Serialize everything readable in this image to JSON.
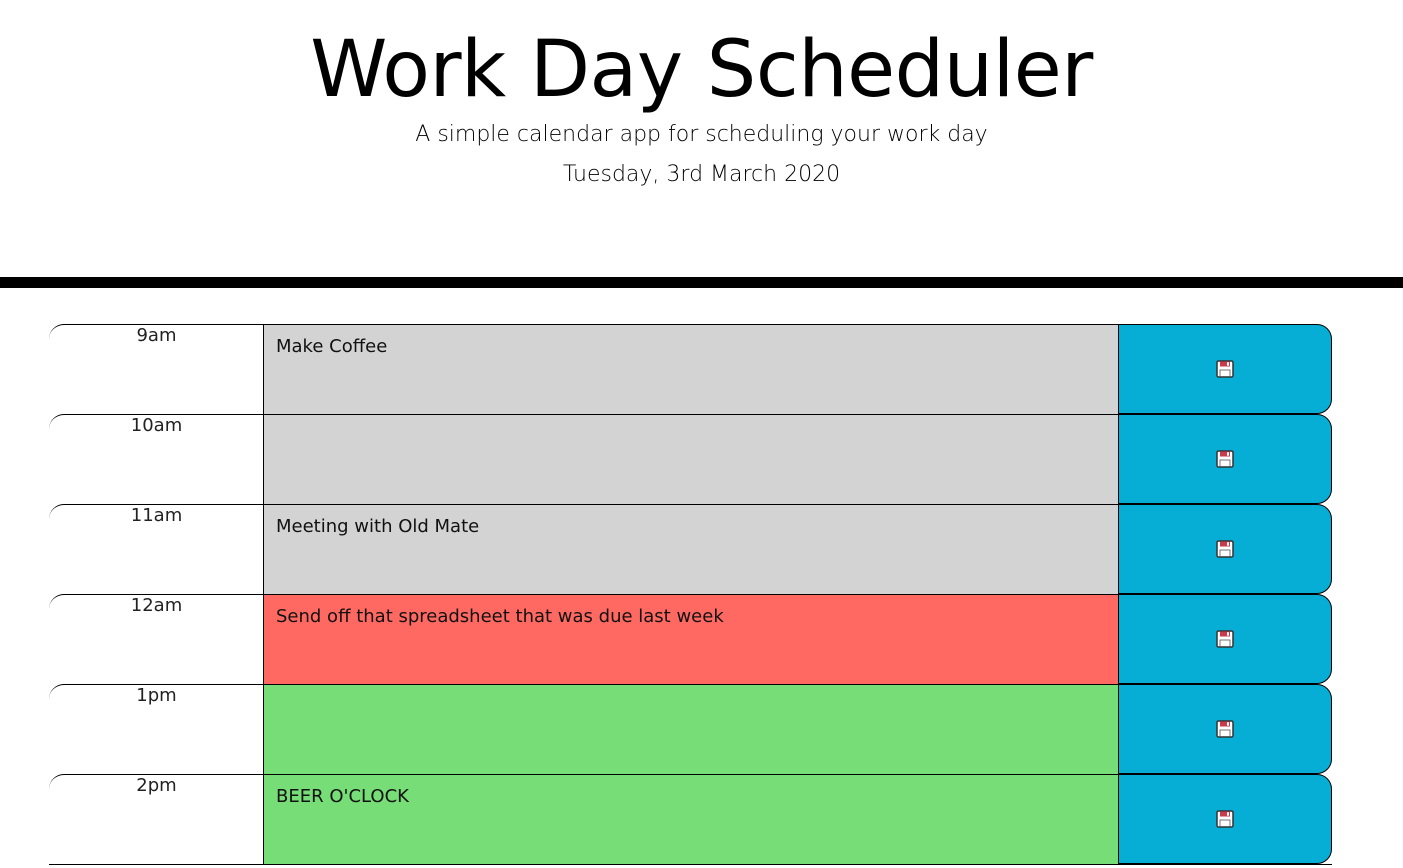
{
  "header": {
    "title": "Work Day Scheduler",
    "subtitle": "A simple calendar app for scheduling your work day",
    "current_day": "Tuesday, 3rd March 2020"
  },
  "colors": {
    "past": "#d3d3d3",
    "present": "#ff6961",
    "future": "#77dd77",
    "save_button": "#06aed5"
  },
  "save_icon": "floppy-disk-icon",
  "rows": [
    {
      "hour": "9am",
      "text": "Make Coffee",
      "state": "past"
    },
    {
      "hour": "10am",
      "text": "",
      "state": "past"
    },
    {
      "hour": "11am",
      "text": "Meeting with Old Mate",
      "state": "past"
    },
    {
      "hour": "12am",
      "text": "Send off that spreadsheet that was due last week",
      "state": "present"
    },
    {
      "hour": "1pm",
      "text": "",
      "state": "future"
    },
    {
      "hour": "2pm",
      "text": "BEER O'CLOCK",
      "state": "future"
    }
  ]
}
